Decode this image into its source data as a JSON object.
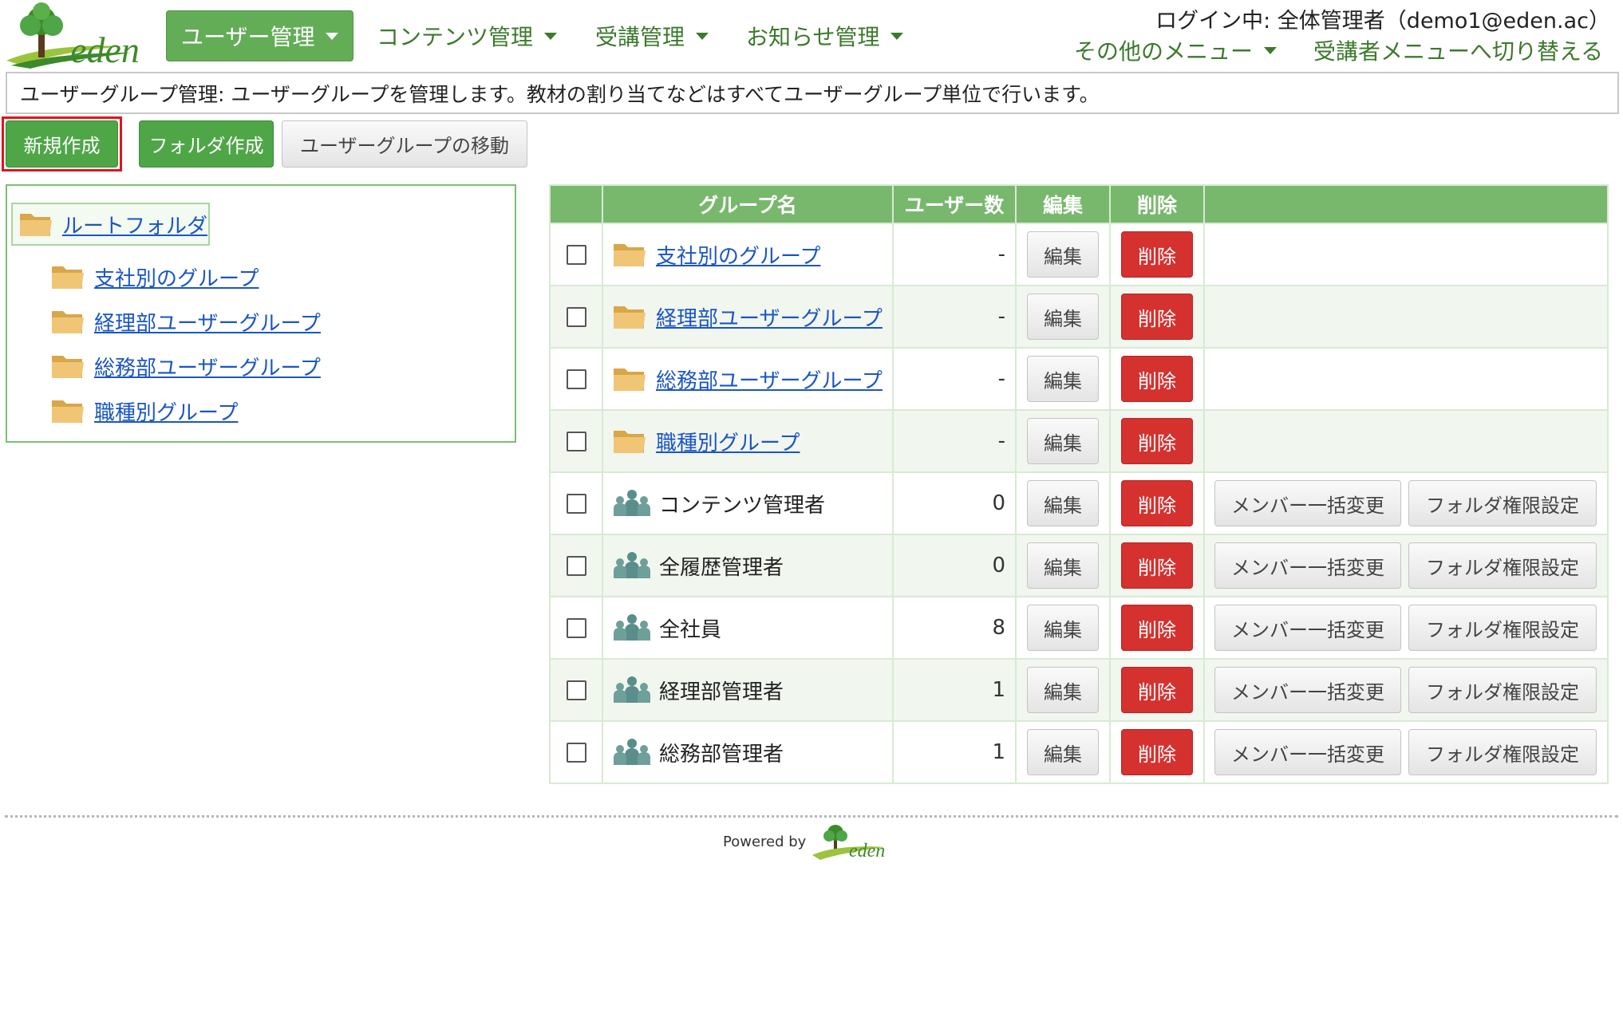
{
  "header": {
    "logo_text": "eden",
    "nav": [
      {
        "label": "ユーザー管理",
        "active": true
      },
      {
        "label": "コンテンツ管理",
        "active": false
      },
      {
        "label": "受講管理",
        "active": false
      },
      {
        "label": "お知らせ管理",
        "active": false
      }
    ],
    "login_text": "ログイン中: 全体管理者（demo1@eden.ac）",
    "other_menu": "その他のメニュー",
    "switch_menu": "受講者メニューへ切り替える"
  },
  "description": "ユーザーグループ管理: ユーザーグループを管理します。教材の割り当てなどはすべてユーザーグループ単位で行います。",
  "toolbar": {
    "new_label": "新規作成",
    "folder_label": "フォルダ作成",
    "move_label": "ユーザーグループの移動"
  },
  "tree": {
    "root": "ルートフォルダ",
    "children": [
      "支社別のグループ",
      "経理部ユーザーグループ",
      "総務部ユーザーグループ",
      "職種別グループ"
    ]
  },
  "table": {
    "headers": {
      "name": "グループ名",
      "users": "ユーザー数",
      "edit": "編集",
      "delete": "削除"
    },
    "edit_label": "編集",
    "delete_label": "削除",
    "member_label": "メンバー一括変更",
    "perm_label": "フォルダ権限設定",
    "rows": [
      {
        "type": "folder",
        "name": "支社別のグループ",
        "count": "-"
      },
      {
        "type": "folder",
        "name": "経理部ユーザーグループ",
        "count": "-"
      },
      {
        "type": "folder",
        "name": "総務部ユーザーグループ",
        "count": "-"
      },
      {
        "type": "folder",
        "name": "職種別グループ",
        "count": "-"
      },
      {
        "type": "group",
        "name": "コンテンツ管理者",
        "count": "0"
      },
      {
        "type": "group",
        "name": "全履歴管理者",
        "count": "0"
      },
      {
        "type": "group",
        "name": "全社員",
        "count": "8"
      },
      {
        "type": "group",
        "name": "経理部管理者",
        "count": "1"
      },
      {
        "type": "group",
        "name": "総務部管理者",
        "count": "1"
      }
    ]
  },
  "footer": {
    "powered_by": "Powered by",
    "logo_text": "eden"
  },
  "colors": {
    "brand_green": "#4ea647",
    "header_green": "#78b86d",
    "danger_red": "#d4312f",
    "link_blue": "#1a55c5"
  }
}
